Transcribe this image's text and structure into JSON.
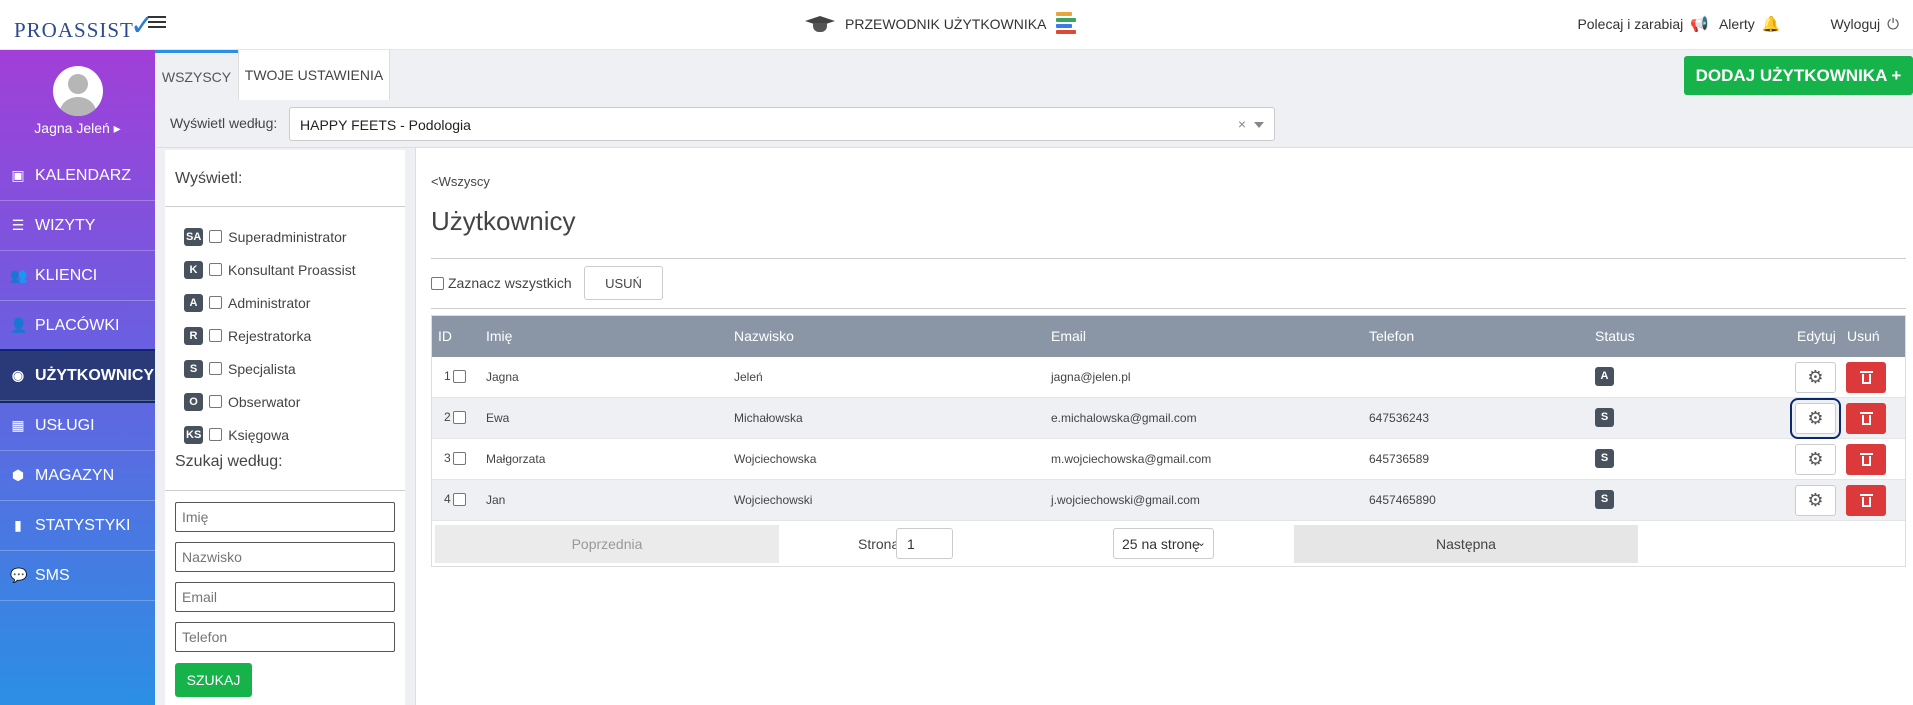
{
  "header": {
    "logo": "PROASSIST",
    "guide_label": "PRZEWODNIK UŻYTKOWNIKA",
    "refer_label": "Polecaj i zarabiaj",
    "alerts_label": "Alerty",
    "logout_label": "Wyloguj"
  },
  "sidebar": {
    "user_name": "Jagna Jeleń ▸",
    "items": [
      {
        "label": "KALENDARZ",
        "icon": "calendar-icon"
      },
      {
        "label": "WIZYTY",
        "icon": "list-icon"
      },
      {
        "label": "KLIENCI",
        "icon": "users-icon"
      },
      {
        "label": "PLACÓWKI",
        "icon": "user-plus-icon"
      },
      {
        "label": "UŻYTKOWNICY",
        "icon": "user-circle-icon",
        "active": true
      },
      {
        "label": "USŁUGI",
        "icon": "grid-icon"
      },
      {
        "label": "MAGAZYN",
        "icon": "box-icon"
      },
      {
        "label": "STATYSTYKI",
        "icon": "bar-chart-icon"
      },
      {
        "label": "SMS",
        "icon": "sms-icon"
      }
    ]
  },
  "tabs": {
    "all": "WSZYSCY",
    "settings": "TWOJE USTAWIENIA",
    "add_user": "DODAJ UŻYTKOWNIKA +"
  },
  "filter": {
    "label": "Wyświetl według:",
    "selected": "HAPPY FEETS - Podologia"
  },
  "panel": {
    "show_title": "Wyświetl:",
    "roles": [
      {
        "badge": "SA",
        "label": "Superadministrator"
      },
      {
        "badge": "K",
        "label": "Konsultant Proassist"
      },
      {
        "badge": "A",
        "label": "Administrator"
      },
      {
        "badge": "R",
        "label": "Rejestratorka"
      },
      {
        "badge": "S",
        "label": "Specjalista"
      },
      {
        "badge": "O",
        "label": "Obserwator"
      },
      {
        "badge": "KS",
        "label": "Księgowa"
      }
    ],
    "search_title": "Szukaj według:",
    "placeholders": {
      "first_name": "Imię",
      "last_name": "Nazwisko",
      "email": "Email",
      "phone": "Telefon"
    },
    "search_button": "SZUKAJ"
  },
  "main": {
    "back_link": "<Wszyscy",
    "title": "Użytkownicy",
    "select_all": "Zaznacz wszystkich",
    "delete_button": "USUŃ"
  },
  "table": {
    "headers": {
      "id": "ID",
      "first_name": "Imię",
      "last_name": "Nazwisko",
      "email": "Email",
      "phone": "Telefon",
      "status": "Status",
      "edit": "Edytuj",
      "delete": "Usuń"
    },
    "rows": [
      {
        "id": "1",
        "first_name": "Jagna",
        "last_name": "Jeleń",
        "email": "jagna@jelen.pl",
        "phone": "",
        "status": "A"
      },
      {
        "id": "2",
        "first_name": "Ewa",
        "last_name": "Michałowska",
        "email": "e.michalowska@gmail.com",
        "phone": "647536243",
        "status": "S"
      },
      {
        "id": "3",
        "first_name": "Małgorzata",
        "last_name": "Wojciechowska",
        "email": "m.wojciechowska@gmail.com",
        "phone": "645736589",
        "status": "S"
      },
      {
        "id": "4",
        "first_name": "Jan",
        "last_name": "Wojciechowski",
        "email": "j.wojciechowski@gmail.com",
        "phone": "6457465890",
        "status": "S"
      }
    ]
  },
  "pager": {
    "prev": "Poprzednia",
    "page_label": "Strona",
    "page_value": "1",
    "per_page": "25 na stronę",
    "next": "Następna"
  }
}
